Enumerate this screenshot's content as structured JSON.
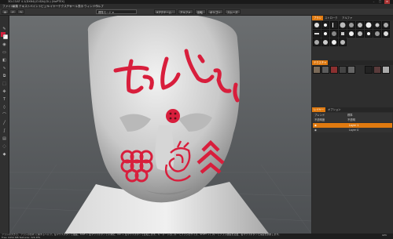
{
  "window": {
    "title": "3D-COAT 4.1(DX64)(CUDA)(GL) (NoPTEX)"
  },
  "menu": {
    "items": [
      "ファイル",
      "編集",
      "テキスト",
      "ペイント",
      "ビュー",
      "レイヤー",
      "テクスチャ",
      "ツール",
      "表示",
      "ウィンドウ",
      "ヘルプ"
    ]
  },
  "toolbar": {
    "mode_dropdown": "標準モード",
    "options": [
      "Xアクテーム",
      "アルファ",
      "反転",
      "ポリゴン",
      "スムーズ"
    ]
  },
  "right_panel": {
    "brush_tabs": [
      "ブラシ",
      "ストローク",
      "アルファ"
    ],
    "texture_tabs": [
      "テクスチャ"
    ],
    "layer_tabs": [
      "レイヤー",
      "オプション"
    ],
    "layer_opts": [
      {
        "label": "ブレンド",
        "value": "標準"
      },
      {
        "label": "不透明度",
        "value": "不透明"
      }
    ],
    "layers": [
      {
        "name": "Layer 1",
        "active": true
      },
      {
        "name": "Layer 0",
        "active": false
      }
    ]
  },
  "status": {
    "line1": "ブラシの大きさ、ブラシの形状 に関するヘルプ。左マウスボタンで描画、Shift + 左マウスボタンで平滑化、Ctrl + 左マウスボタンで反転します。キーボードの[ ]キーでブラシのサイズ、SHIFT + [ ]キーでブラシ硬度を変更、右マウスボタンで深度を調整します。",
    "line2": "Free: 6450 MB  Textures: 326 KTS",
    "right": "GPU"
  },
  "colors": {
    "accent": "#e07a10",
    "paint_red": "#d81e3c"
  },
  "icons": {
    "close": "close-icon",
    "minimize": "minimize-icon",
    "maximize": "maximize-icon"
  }
}
